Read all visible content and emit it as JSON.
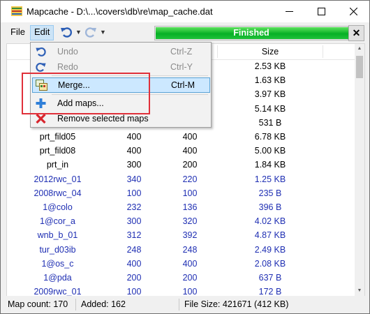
{
  "window": {
    "title": "Mapcache - D:\\...\\covers\\db\\re\\map_cache.dat"
  },
  "titlebar": {
    "minimize_icon": "minimize-icon",
    "maximize_icon": "maximize-icon",
    "close_icon": "close-icon"
  },
  "menubar": {
    "file": "File",
    "edit": "Edit"
  },
  "toolbar": {
    "undo_icon": "undo-icon",
    "redo_icon": "redo-icon",
    "progress_text": "Finished",
    "progress_value": 1.0,
    "close_label": "✕"
  },
  "table": {
    "headers": {
      "name": "",
      "width": "",
      "height": "",
      "size": "Size"
    },
    "rows": [
      {
        "name": "",
        "w": "",
        "h": "",
        "size": "2.53 KB",
        "blue": false
      },
      {
        "name": "",
        "w": "",
        "h": "",
        "size": "1.63 KB",
        "blue": false
      },
      {
        "name": "",
        "w": "",
        "h": "",
        "size": "3.97 KB",
        "blue": false
      },
      {
        "name": "",
        "w": "",
        "h": "",
        "size": "5.14 KB",
        "blue": false
      },
      {
        "name": "",
        "w": "",
        "h": "",
        "size": "531 B",
        "blue": false
      },
      {
        "name": "prt_fild05",
        "w": "400",
        "h": "400",
        "size": "6.78 KB",
        "blue": false
      },
      {
        "name": "prt_fild08",
        "w": "400",
        "h": "400",
        "size": "5.00 KB",
        "blue": false
      },
      {
        "name": "prt_in",
        "w": "300",
        "h": "200",
        "size": "1.84 KB",
        "blue": false
      },
      {
        "name": "2012rwc_01",
        "w": "340",
        "h": "220",
        "size": "1.25 KB",
        "blue": true
      },
      {
        "name": "2008rwc_04",
        "w": "100",
        "h": "100",
        "size": "235 B",
        "blue": true
      },
      {
        "name": "1@colo",
        "w": "232",
        "h": "136",
        "size": "396 B",
        "blue": true
      },
      {
        "name": "1@cor_a",
        "w": "300",
        "h": "320",
        "size": "4.02 KB",
        "blue": true
      },
      {
        "name": "wnb_b_01",
        "w": "312",
        "h": "392",
        "size": "4.87 KB",
        "blue": true
      },
      {
        "name": "tur_d03ib",
        "w": "248",
        "h": "248",
        "size": "2.49 KB",
        "blue": true
      },
      {
        "name": "1@os_c",
        "w": "400",
        "h": "400",
        "size": "2.08 KB",
        "blue": true
      },
      {
        "name": "1@pda",
        "w": "200",
        "h": "200",
        "size": "637 B",
        "blue": true
      },
      {
        "name": "2009rwc_01",
        "w": "100",
        "h": "100",
        "size": "172 B",
        "blue": true
      }
    ]
  },
  "edit_menu": {
    "items": [
      {
        "label": "Undo",
        "shortcut": "Ctrl-Z",
        "icon": "undo-icon",
        "disabled": true
      },
      {
        "label": "Redo",
        "shortcut": "Ctrl-Y",
        "icon": "redo-icon",
        "disabled": true
      },
      {
        "label": "Merge...",
        "shortcut": "Ctrl-M",
        "icon": "merge-icon",
        "disabled": false,
        "highlighted": true
      },
      {
        "label": "Add maps...",
        "shortcut": "",
        "icon": "add-icon",
        "disabled": false
      },
      {
        "label": "Remove selected maps",
        "shortcut": "",
        "icon": "remove-icon",
        "disabled": false
      }
    ]
  },
  "statusbar": {
    "map_count": "Map count: 170",
    "added": "Added: 162",
    "file_size": "File Size: 421671 (412 KB)"
  },
  "colors": {
    "accent": "#06b025",
    "highlight": "#cce8ff",
    "annotation": "#e0303a",
    "blue_text": "#1f2fb3"
  }
}
